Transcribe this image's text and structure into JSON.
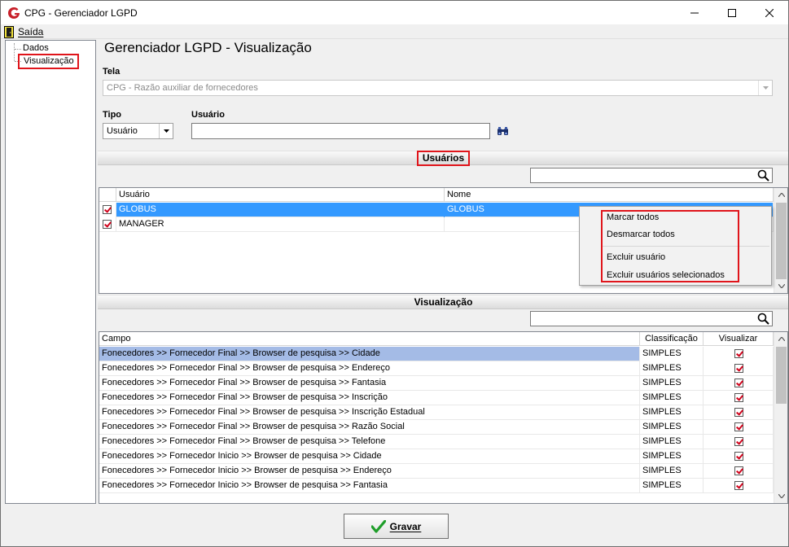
{
  "window": {
    "title": "CPG - Gerenciador LGPD"
  },
  "menu": {
    "saida": "Saída"
  },
  "tree": {
    "items": [
      "Dados",
      "Visualização"
    ]
  },
  "page": {
    "title": "Gerenciador LGPD - Visualização"
  },
  "tela": {
    "label": "Tela",
    "value": "CPG - Razão auxiliar de fornecedores"
  },
  "tipo": {
    "label": "Tipo",
    "value": "Usuário"
  },
  "usuario": {
    "label": "Usuário",
    "value": ""
  },
  "usuarios_section": {
    "title": "Usuários",
    "search": ""
  },
  "users_grid": {
    "columns": [
      "Usuário",
      "Nome"
    ],
    "rows": [
      {
        "usuario": "GLOBUS",
        "nome": "GLOBUS",
        "checked": true,
        "selected": true
      },
      {
        "usuario": "MANAGER",
        "nome": "",
        "checked": true,
        "selected": false
      }
    ]
  },
  "context_menu": {
    "items": [
      "Marcar todos",
      "Desmarcar todos",
      "Excluir usuário",
      "Excluir usuários selecionados"
    ]
  },
  "visualizacao_section": {
    "title": "Visualização",
    "search": ""
  },
  "fields_grid": {
    "columns": [
      "Campo",
      "Classificação",
      "Visualizar"
    ],
    "rows": [
      {
        "campo": "Fonecedores >> Fornecedor  Final >> Browser de pesquisa >> Cidade",
        "classificacao": "SIMPLES",
        "visualizar": true,
        "selected": true
      },
      {
        "campo": "Fonecedores >> Fornecedor  Final >> Browser de pesquisa >> Endereço",
        "classificacao": "SIMPLES",
        "visualizar": true
      },
      {
        "campo": "Fonecedores >> Fornecedor  Final >> Browser de pesquisa >> Fantasia",
        "classificacao": "SIMPLES",
        "visualizar": true
      },
      {
        "campo": "Fonecedores >> Fornecedor  Final >> Browser de pesquisa >> Inscrição",
        "classificacao": "SIMPLES",
        "visualizar": true
      },
      {
        "campo": "Fonecedores >> Fornecedor  Final >> Browser de pesquisa >> Inscrição Estadual",
        "classificacao": "SIMPLES",
        "visualizar": true
      },
      {
        "campo": "Fonecedores >> Fornecedor  Final >> Browser de pesquisa >> Razão Social",
        "classificacao": "SIMPLES",
        "visualizar": true
      },
      {
        "campo": "Fonecedores >> Fornecedor  Final >> Browser de pesquisa >> Telefone",
        "classificacao": "SIMPLES",
        "visualizar": true
      },
      {
        "campo": "Fonecedores >> Fornecedor  Inicio >> Browser de pesquisa >> Cidade",
        "classificacao": "SIMPLES",
        "visualizar": true
      },
      {
        "campo": "Fonecedores >> Fornecedor  Inicio >> Browser de pesquisa >> Endereço",
        "classificacao": "SIMPLES",
        "visualizar": true
      },
      {
        "campo": "Fonecedores >> Fornecedor  Inicio >> Browser de pesquisa >> Fantasia",
        "classificacao": "SIMPLES",
        "visualizar": true
      }
    ]
  },
  "footer": {
    "gravar": "Gravar"
  },
  "colors": {
    "highlight_user": "#3399ff",
    "highlight_field": "#a4bbe6",
    "annotation_red": "#e0151b"
  }
}
